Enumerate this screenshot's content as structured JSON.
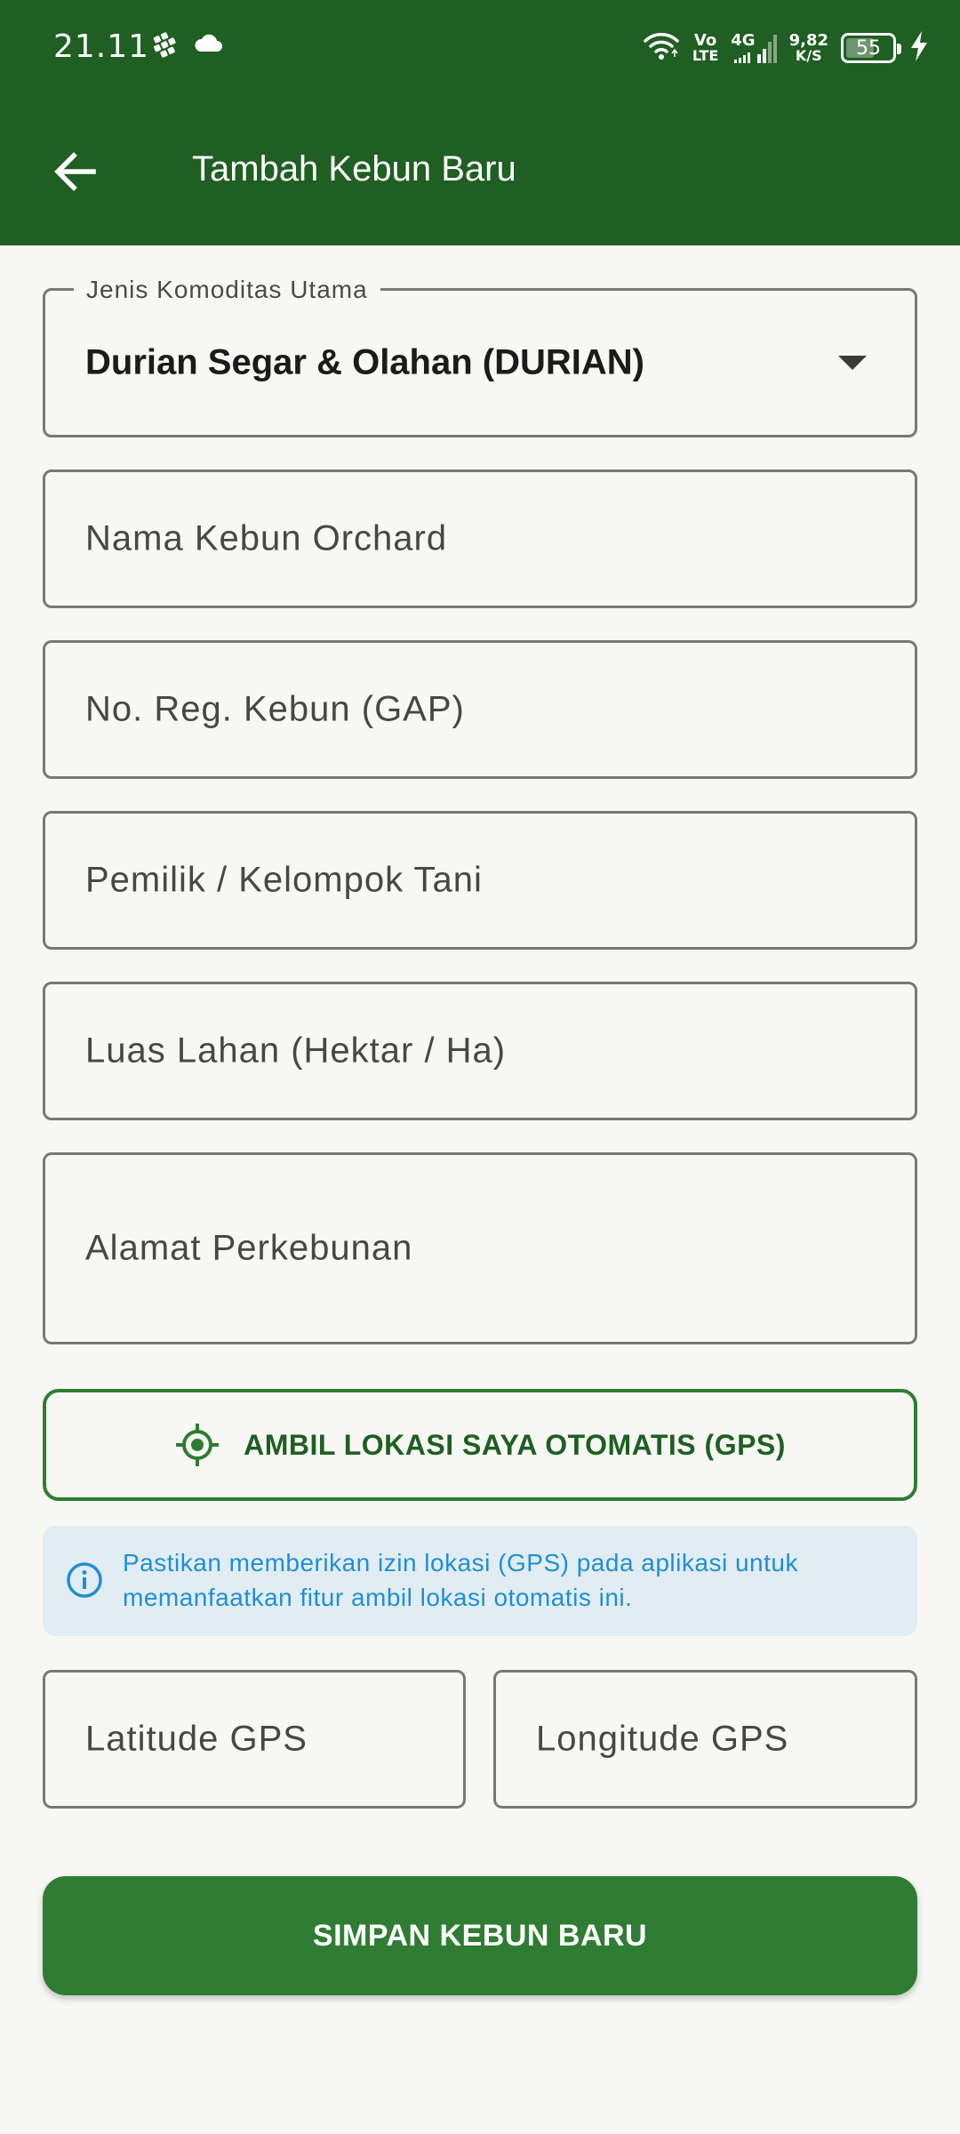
{
  "status_bar": {
    "time": "21.11",
    "volte_top": "Vo",
    "volte_bottom": "LTE",
    "network": "4G",
    "speed_value": "9,82",
    "speed_unit": "K/S",
    "battery_level": "55"
  },
  "app_bar": {
    "title": "Tambah Kebun Baru",
    "back_icon": "arrow-left-icon",
    "background_color": "#1f5f22"
  },
  "form": {
    "commodity": {
      "label": "Jenis Komoditas Utama",
      "value": "Durian Segar & Olahan (DURIAN)"
    },
    "orchard_name": {
      "placeholder": "Nama Kebun Orchard"
    },
    "registration_no": {
      "placeholder": "No. Reg. Kebun (GAP)"
    },
    "owner": {
      "placeholder": "Pemilik / Kelompok Tani"
    },
    "land_area": {
      "placeholder": "Luas Lahan (Hektar / Ha)"
    },
    "address": {
      "placeholder": "Alamat Perkebunan"
    },
    "gps_button": {
      "label": "AMBIL LOKASI SAYA OTOMATIS (GPS)",
      "icon": "gps-target-icon"
    },
    "info": {
      "icon": "info-icon",
      "text_line1": "Pastikan memberikan izin lokasi (GPS) pada aplikasi untuk",
      "text_line2": "memanfaatkan fitur ambil lokasi otomatis ini."
    },
    "latitude": {
      "placeholder": "Latitude GPS"
    },
    "longitude": {
      "placeholder": "Longitude GPS"
    },
    "submit": {
      "label": "SIMPAN KEBUN BARU"
    }
  },
  "colors": {
    "primary": "#2e7d32",
    "primary_dark": "#1f5f22",
    "info_text": "#1f8fd6",
    "info_bg": "#e1edf3",
    "background": "#f7f8f4"
  }
}
